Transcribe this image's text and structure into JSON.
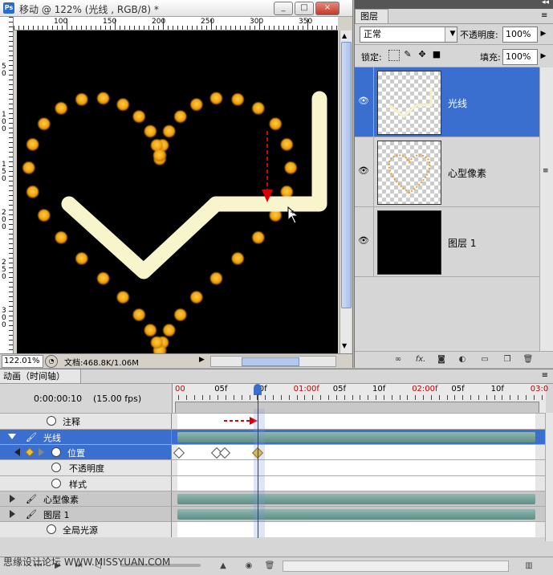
{
  "document": {
    "title": "移动 @ 122% (光线 , RGB/8) *",
    "app_icon": "Ps",
    "window_buttons": [
      "_",
      "□",
      "×"
    ],
    "ruler_top_labels": [
      "100",
      "150",
      "200",
      "250",
      "300",
      "350"
    ],
    "ruler_left_labels": [
      "5 0",
      "1 0 0",
      "1 5 0",
      "2 0 0",
      "2 5 0",
      "3 0 0",
      "3 5 0"
    ],
    "zoom": "122.01%",
    "doc_info": "文档:468.8K/1.06M"
  },
  "layers_panel": {
    "tab": "图层",
    "blend_mode": "正常",
    "opacity_label": "不透明度:",
    "opacity": "100%",
    "lock_label": "锁定:",
    "fill_label": "填充:",
    "fill": "100%",
    "layers": [
      {
        "name": "光线",
        "selected": true,
        "visible": true
      },
      {
        "name": "心型像素",
        "selected": false,
        "visible": true
      },
      {
        "name": "图层 1",
        "selected": false,
        "visible": true
      }
    ],
    "footer_icons": [
      "link-icon",
      "fx-icon",
      "mask-icon",
      "adjustment-icon",
      "group-icon",
      "new-layer-icon",
      "trash-icon"
    ]
  },
  "animation_panel": {
    "tab": "动画（时间轴）",
    "timecode": "0:00:00:10",
    "fps": "(15.00 fps)",
    "ruler_labels": [
      {
        "text": "00",
        "red": true
      },
      {
        "text": "05f",
        "red": false
      },
      {
        "text": "10f",
        "red": false
      },
      {
        "text": "01:00f",
        "red": true
      },
      {
        "text": "05f",
        "red": false
      },
      {
        "text": "10f",
        "red": false
      },
      {
        "text": "02:00f",
        "red": true
      },
      {
        "text": "05f",
        "red": false
      },
      {
        "text": "10f",
        "red": false
      },
      {
        "text": "03:0",
        "red": true
      }
    ],
    "rows": [
      {
        "label": "注释",
        "kind": "prop"
      },
      {
        "label": "光线",
        "kind": "layer-selected"
      },
      {
        "label": "位置",
        "kind": "prop-selected"
      },
      {
        "label": "不透明度",
        "kind": "prop"
      },
      {
        "label": "样式",
        "kind": "prop"
      },
      {
        "label": "心型像素",
        "kind": "layer"
      },
      {
        "label": "图层 1",
        "kind": "layer"
      },
      {
        "label": "全局光源",
        "kind": "prop"
      }
    ],
    "watermark": "思缘设计论坛  WWW.MISSYUAN.COM"
  },
  "colors": {
    "accent": "#3a6fd0",
    "dot": "#f0a010",
    "beam": "#f8f4cc",
    "guide": "#dd0000",
    "track": "#6f9c95"
  }
}
